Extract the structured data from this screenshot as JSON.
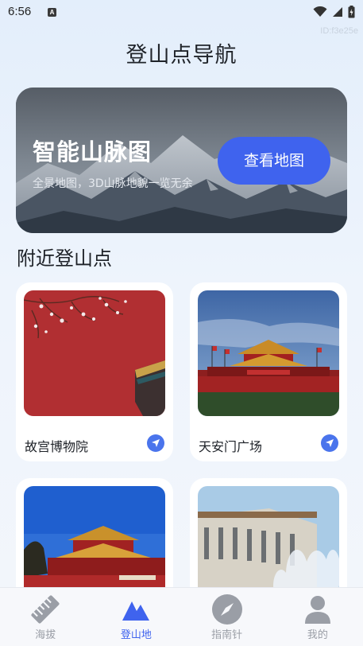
{
  "status_bar": {
    "time": "6:56",
    "notification_letter": "A",
    "device_id": "ID:f3e25e"
  },
  "page": {
    "title": "登山点导航"
  },
  "banner": {
    "title": "智能山脉图",
    "subtitle": "全景地图，3D山脉地貌一览无余",
    "button_label": "查看地图"
  },
  "nearby": {
    "title": "附近登山点",
    "spots": [
      {
        "name": "故宫博物院"
      },
      {
        "name": "天安门广场"
      },
      {
        "name": ""
      },
      {
        "name": ""
      }
    ]
  },
  "tabbar": {
    "active": "登山地",
    "tabs": [
      {
        "label": "海拔",
        "icon": "ruler-icon"
      },
      {
        "label": "登山地",
        "icon": "mountain-icon"
      },
      {
        "label": "指南针",
        "icon": "compass-icon"
      },
      {
        "label": "我的",
        "icon": "person-icon"
      }
    ]
  },
  "colors": {
    "accent": "#3f63ee",
    "nav_button": "#4a74ec",
    "tab_inactive": "#9a9ea6"
  }
}
